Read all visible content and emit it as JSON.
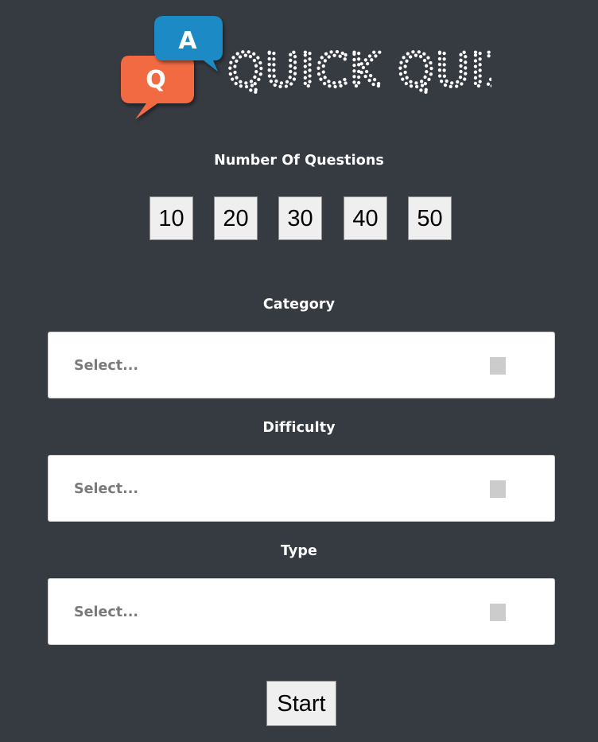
{
  "app": {
    "title": "QUICK QUIZ",
    "logo_letters": {
      "question": "Q",
      "answer": "A"
    },
    "colors": {
      "background": "#363a41",
      "bubble_q": "#f26b43",
      "bubble_a": "#1a8ac4",
      "title_dots": "#ffffff"
    }
  },
  "questions": {
    "label": "Number Of Questions",
    "options": [
      "10",
      "20",
      "30",
      "40",
      "50"
    ]
  },
  "category": {
    "label": "Category",
    "placeholder": "Select..."
  },
  "difficulty": {
    "label": "Difficulty",
    "placeholder": "Select..."
  },
  "type": {
    "label": "Type",
    "placeholder": "Select..."
  },
  "actions": {
    "start_label": "Start"
  }
}
